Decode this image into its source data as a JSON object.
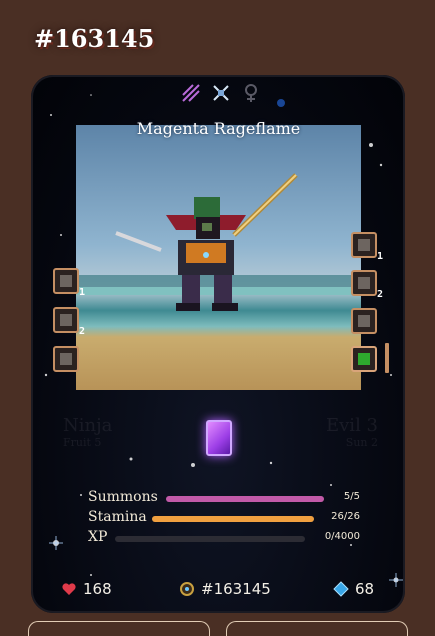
{
  "header": {
    "id_title": "#163145"
  },
  "card": {
    "name": "Magenta Rageflame",
    "top_icons": [
      "stripes-icon",
      "crossed-swords-icon",
      "female-symbol-icon"
    ],
    "left_slots": [
      {
        "icon": "rook-icon",
        "count": "1",
        "active": false
      },
      {
        "icon": "rook-icon",
        "count": "2",
        "active": false
      },
      {
        "icon": "tower-icon",
        "count": "",
        "active": false
      }
    ],
    "right_slots": [
      {
        "icon": "hammer-icon",
        "count": "1",
        "active": false
      },
      {
        "icon": "hammer-icon",
        "count": "2",
        "active": false
      },
      {
        "icon": "skull-icon",
        "count": "",
        "active": false
      },
      {
        "icon": "creeper-icon",
        "count": "",
        "active": true
      }
    ],
    "ghost_left": {
      "line1": "Ninja",
      "line2": "Fruit 5"
    },
    "ghost_right": {
      "line1": "Evil 3",
      "line2": "Sun 2"
    },
    "stats": [
      {
        "label": "Summons",
        "value": "5/5",
        "fraction": 1.0,
        "color": "#c25aa8"
      },
      {
        "label": "Stamina",
        "value": "26/26",
        "fraction": 1.0,
        "color": "#f0a040"
      },
      {
        "label": "XP",
        "value": "0/4000",
        "fraction": 0.0,
        "color": "#4a4a54"
      }
    ],
    "footer": {
      "hearts": "168",
      "token": "#163145",
      "gems": "68"
    }
  },
  "colors": {
    "background": "#4a2f24",
    "card": "#05070f",
    "slot_border": "#c58f63",
    "accent_heart": "#e03a4a",
    "accent_gem": "#38a6e8"
  }
}
